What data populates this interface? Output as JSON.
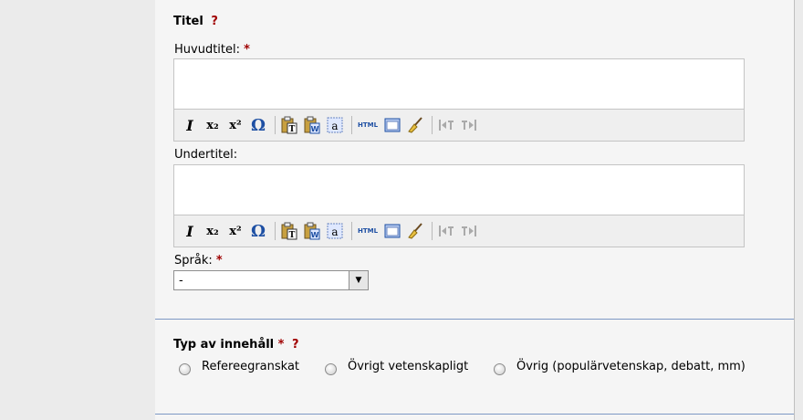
{
  "title_section": {
    "heading": "Titel",
    "help": "?"
  },
  "main_title": {
    "label": "Huvudtitel:",
    "required": "*",
    "value": ""
  },
  "subtitle": {
    "label": "Undertitel:",
    "value": ""
  },
  "language": {
    "label": "Språk:",
    "required": "*",
    "selected": "-"
  },
  "content_type": {
    "heading": "Typ av innehåll",
    "required": "*",
    "help": "?",
    "options": [
      "Refereegranskat",
      "Övrigt vetenskapligt",
      "Övrig (populärvetenskap, debatt, mm)"
    ]
  },
  "toolbar": {
    "italic": "I",
    "subscript": "x₂",
    "superscript": "x²",
    "special_char": "Ω",
    "html": "HTML",
    "paste_text": "T",
    "paste_word": "W",
    "select_all": "a"
  },
  "colors": {
    "required": "#a00000",
    "divider": "#7d98c4",
    "panel": "#f5f5f5"
  }
}
